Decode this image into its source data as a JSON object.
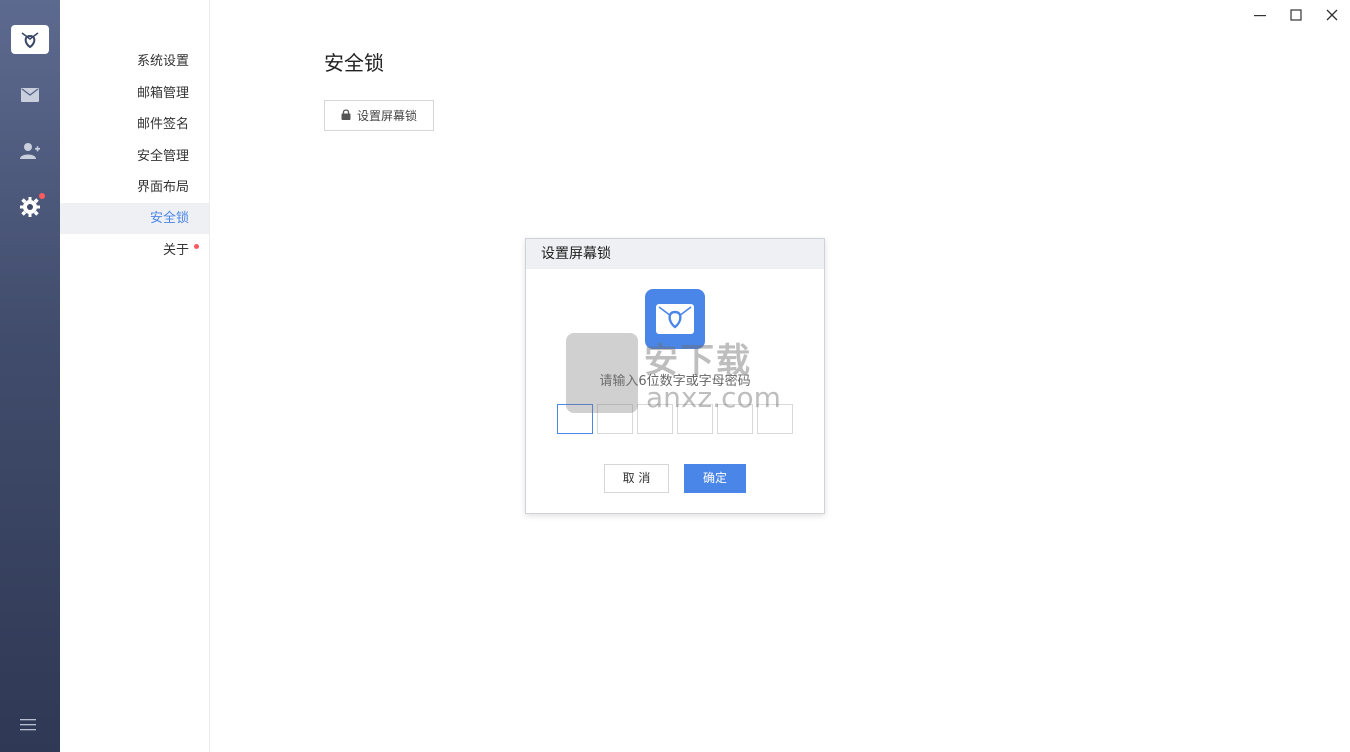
{
  "nav": {
    "items": [
      {
        "label": "系统设置"
      },
      {
        "label": "邮箱管理"
      },
      {
        "label": "邮件签名"
      },
      {
        "label": "安全管理"
      },
      {
        "label": "界面布局"
      },
      {
        "label": "安全锁"
      },
      {
        "label": "关于"
      }
    ],
    "active_index": 5
  },
  "rail": {
    "icons": [
      "mail-icon",
      "contacts-icon",
      "settings-icon",
      "menu-icon"
    ]
  },
  "main": {
    "title": "安全锁",
    "lock_button_label": "设置屏幕锁"
  },
  "dialog": {
    "title": "设置屏幕锁",
    "prompt": "请输入6位数字或字母密码",
    "pin_count": 6,
    "cancel_label": "取 消",
    "ok_label": "确定"
  },
  "watermark": {
    "cn": "安下载",
    "en": "anxz.com"
  },
  "colors": {
    "accent": "#4a86e8",
    "badge": "#ff5a5f"
  }
}
